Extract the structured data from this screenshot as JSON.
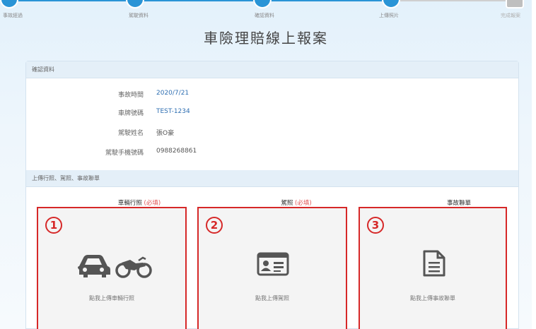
{
  "stepper": {
    "steps": [
      {
        "label": "事故經過",
        "state": "done"
      },
      {
        "label": "駕駛資料",
        "state": "done"
      },
      {
        "label": "確認資料",
        "state": "done"
      },
      {
        "label": "上傳照片",
        "state": "current"
      },
      {
        "label": "完成報案",
        "state": "pending"
      }
    ]
  },
  "page_title": "車險理賠線上報案",
  "confirm_section": {
    "heading": "確認資料",
    "rows": [
      {
        "label": "事故時間",
        "value": "2020/7/21"
      },
      {
        "label": "車牌號碼",
        "value": "TEST-1234"
      },
      {
        "label": "駕駛姓名",
        "value": "張O豪"
      },
      {
        "label": "駕駛手機號碼",
        "value": "0988268861"
      }
    ]
  },
  "upload_section": {
    "heading": "上傳行照、駕照、事故聯單",
    "columns": [
      {
        "title": "車輛行照",
        "required": "(必填)",
        "number": "1",
        "caption": "點我上傳車輛行照",
        "icon": "car-motorcycle-icon"
      },
      {
        "title": "駕照",
        "required": "(必填)",
        "number": "2",
        "caption": "點我上傳駕照",
        "icon": "id-card-icon"
      },
      {
        "title": "事故聯單",
        "required": "",
        "number": "3",
        "caption": "點我上傳事故聯單",
        "icon": "document-icon"
      }
    ]
  },
  "colors": {
    "accent": "#2a94d6",
    "highlight_border": "#d62828",
    "required": "#e05555"
  }
}
